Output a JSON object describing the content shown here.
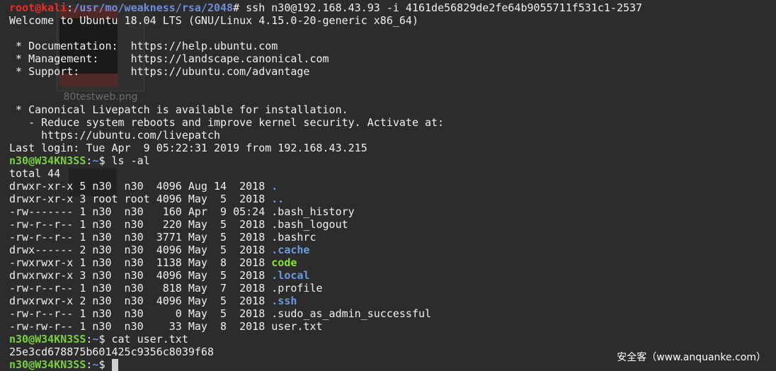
{
  "theme": {
    "background": "#2c2c2c",
    "foreground": "#f0f0f0",
    "root_prompt": "#e5302a",
    "path": "#6e8cd7",
    "user_prompt": "#78cf3f",
    "directory": "#6a9be0",
    "executable": "#8ae234",
    "cursor": "#d0d0d0"
  },
  "desktop": {
    "icons": [
      {
        "label": "80testweb.png"
      }
    ]
  },
  "session": {
    "root_prompt": {
      "user_host": "root@kali",
      "colon": ":",
      "cwd": "/usr/mo/weakness/rsa/2048",
      "symbol": "# ",
      "command": "ssh n30@192.168.43.93 -i 4161de56829de2fe64b9055711f531c1-2537"
    },
    "motd": [
      "Welcome to Ubuntu 18.04 LTS (GNU/Linux 4.15.0-20-generic x86_64)",
      " * Documentation:  https://help.ubuntu.com",
      " * Management:     https://landscape.canonical.com",
      " * Support:        https://ubuntu.com/advantage",
      " * Canonical Livepatch is available for installation.",
      "   - Reduce system reboots and improve kernel security. Activate at:",
      "     https://ubuntu.com/livepatch"
    ],
    "last_login": "Last login: Tue Apr  9 05:22:31 2019 from 192.168.43.215",
    "prompt": {
      "user_host": "n30@W34KN3SS",
      "colon": ":",
      "cwd": "~",
      "symbol": "$ "
    },
    "commands": [
      "ls -al",
      "cat user.txt"
    ],
    "ls_total": "total 44",
    "ls_entries": [
      {
        "info": "drwxr-xr-x 5 n30  n30  4096 Aug 14  2018 ",
        "name": "."
      },
      {
        "info": "drwxr-xr-x 3 root root 4096 May  5  2018 ",
        "name": ".."
      },
      {
        "info": "-rw------- 1 n30  n30   160 Apr  9 05:24 ",
        "name": ".bash_history"
      },
      {
        "info": "-rw-r--r-- 1 n30  n30   220 May  5  2018 ",
        "name": ".bash_logout"
      },
      {
        "info": "-rw-r--r-- 1 n30  n30  3771 May  5  2018 ",
        "name": ".bashrc"
      },
      {
        "info": "drwx------ 2 n30  n30  4096 May  5  2018 ",
        "name": ".cache"
      },
      {
        "info": "-rwxrwxr-x 1 n30  n30  1138 May  8  2018 ",
        "name": "code"
      },
      {
        "info": "drwxrwxr-x 3 n30  n30  4096 May  5  2018 ",
        "name": ".local"
      },
      {
        "info": "-rw-r--r-- 1 n30  n30   818 May  7  2018 ",
        "name": ".profile"
      },
      {
        "info": "drwxrwxr-x 2 n30  n30  4096 May  5  2018 ",
        "name": ".ssh"
      },
      {
        "info": "-rw-r--r-- 1 n30  n30     0 May  5  2018 ",
        "name": ".sudo_as_admin_successful"
      },
      {
        "info": "-rw-rw-r-- 1 n30  n30    33 May  8  2018 ",
        "name": "user.txt"
      }
    ],
    "user_txt": "25e3cd678875b601425c9356c8039f68"
  },
  "watermark": {
    "text": "安全客（www.anquanke.com）"
  }
}
